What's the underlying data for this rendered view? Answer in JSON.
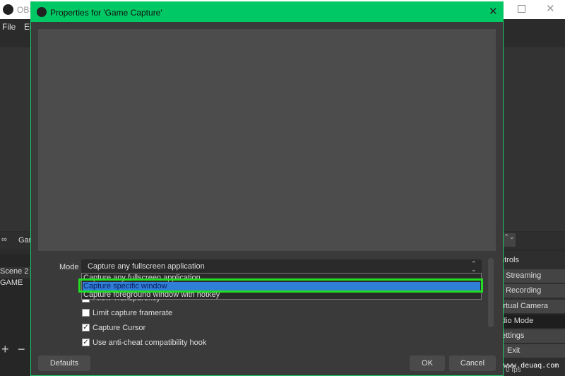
{
  "main_window": {
    "title": "OBS",
    "menu": [
      "File",
      "Ed"
    ],
    "scenes": [
      "Scene 2",
      "GAME"
    ],
    "source_label": "Gan",
    "controls_title": "ntrols",
    "controls": [
      "t Streaming",
      "t Recording",
      "irtual Camera",
      "dio Mode",
      "ettings",
      "Exit"
    ],
    "status": "0 fps"
  },
  "dialog": {
    "title": "Properties for 'Game Capture'",
    "mode_label": "Mode",
    "mode_value": "Capture any fullscreen application",
    "mode_options": [
      "Capture any fullscreen application",
      "Capture specific window",
      "Capture foreground window with hotkey"
    ],
    "highlighted_option": 1,
    "checkboxes": [
      {
        "label": "Allow Transparency",
        "checked": false
      },
      {
        "label": "Limit capture framerate",
        "checked": false
      },
      {
        "label": "Capture Cursor",
        "checked": true
      },
      {
        "label": "Use anti-cheat compatibility hook",
        "checked": true
      }
    ],
    "defaults": "Defaults",
    "ok": "OK",
    "cancel": "Cancel"
  },
  "watermark": "www.deuaq.com",
  "colors": {
    "accent": "#00c864",
    "highlight": "#2f7fd8",
    "outline": "#22dd22"
  }
}
